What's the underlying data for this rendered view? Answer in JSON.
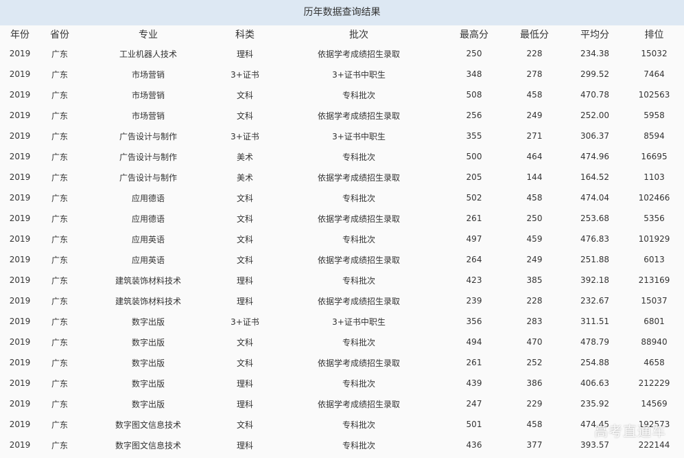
{
  "title": "历年数据查询结果",
  "columns": [
    "年份",
    "省份",
    "专业",
    "科类",
    "批次",
    "最高分",
    "最低分",
    "平均分",
    "排位"
  ],
  "rows": [
    [
      "2019",
      "广东",
      "工业机器人技术",
      "理科",
      "依据学考成绩招生录取",
      "250",
      "228",
      "234.38",
      "15032"
    ],
    [
      "2019",
      "广东",
      "市场营销",
      "3+证书",
      "3+证书中职生",
      "348",
      "278",
      "299.52",
      "7464"
    ],
    [
      "2019",
      "广东",
      "市场营销",
      "文科",
      "专科批次",
      "508",
      "458",
      "470.78",
      "102563"
    ],
    [
      "2019",
      "广东",
      "市场营销",
      "文科",
      "依据学考成绩招生录取",
      "256",
      "249",
      "252.00",
      "5958"
    ],
    [
      "2019",
      "广东",
      "广告设计与制作",
      "3+证书",
      "3+证书中职生",
      "355",
      "271",
      "306.37",
      "8594"
    ],
    [
      "2019",
      "广东",
      "广告设计与制作",
      "美术",
      "专科批次",
      "500",
      "464",
      "474.96",
      "16695"
    ],
    [
      "2019",
      "广东",
      "广告设计与制作",
      "美术",
      "依据学考成绩招生录取",
      "205",
      "144",
      "164.52",
      "1103"
    ],
    [
      "2019",
      "广东",
      "应用德语",
      "文科",
      "专科批次",
      "502",
      "458",
      "474.04",
      "102466"
    ],
    [
      "2019",
      "广东",
      "应用德语",
      "文科",
      "依据学考成绩招生录取",
      "261",
      "250",
      "253.68",
      "5356"
    ],
    [
      "2019",
      "广东",
      "应用英语",
      "文科",
      "专科批次",
      "497",
      "459",
      "476.83",
      "101929"
    ],
    [
      "2019",
      "广东",
      "应用英语",
      "文科",
      "依据学考成绩招生录取",
      "264",
      "249",
      "251.88",
      "6013"
    ],
    [
      "2019",
      "广东",
      "建筑装饰材料技术",
      "理科",
      "专科批次",
      "423",
      "385",
      "392.18",
      "213169"
    ],
    [
      "2019",
      "广东",
      "建筑装饰材料技术",
      "理科",
      "依据学考成绩招生录取",
      "239",
      "228",
      "232.67",
      "15037"
    ],
    [
      "2019",
      "广东",
      "数字出版",
      "3+证书",
      "3+证书中职生",
      "356",
      "283",
      "311.51",
      "6801"
    ],
    [
      "2019",
      "广东",
      "数字出版",
      "文科",
      "专科批次",
      "494",
      "470",
      "478.79",
      "88940"
    ],
    [
      "2019",
      "广东",
      "数字出版",
      "文科",
      "依据学考成绩招生录取",
      "261",
      "252",
      "254.88",
      "4658"
    ],
    [
      "2019",
      "广东",
      "数字出版",
      "理科",
      "专科批次",
      "439",
      "386",
      "406.63",
      "212229"
    ],
    [
      "2019",
      "广东",
      "数字出版",
      "理科",
      "依据学考成绩招生录取",
      "247",
      "229",
      "235.92",
      "14569"
    ],
    [
      "2019",
      "广东",
      "数字图文信息技术",
      "文科",
      "专科批次",
      "501",
      "458",
      "474.45",
      "192573"
    ],
    [
      "2019",
      "广东",
      "数字图文信息技术",
      "理科",
      "专科批次",
      "436",
      "377",
      "393.57",
      "222144"
    ]
  ],
  "watermark": "高考直通车",
  "colors": {
    "title_bg": "#dde8f3",
    "table_bg": "#fafafa",
    "text": "#333333"
  }
}
